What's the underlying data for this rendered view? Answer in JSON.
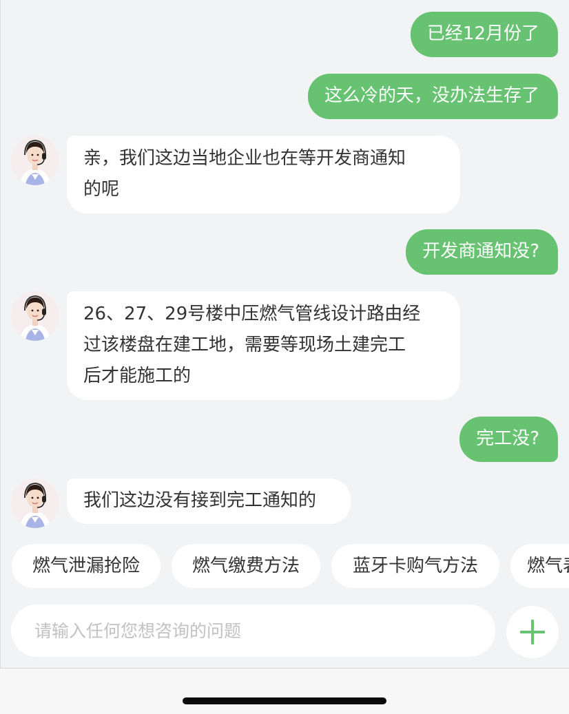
{
  "messages": [
    {
      "side": "out",
      "text": "已经12月份了"
    },
    {
      "side": "out",
      "text": "这么冷的天，没办法生存了"
    },
    {
      "side": "in",
      "lines": [
        "亲，我们这边当地企业也在等开发商通知",
        "的呢"
      ]
    },
    {
      "side": "out",
      "text": "开发商通知没?"
    },
    {
      "side": "in",
      "lines": [
        "26、27、29号楼中压燃气管线设计路由经",
        "过该楼盘在建工地，需要等现场土建完工",
        "后才能施工的"
      ]
    },
    {
      "side": "out",
      "text": "完工没?"
    },
    {
      "side": "in",
      "lines": [
        "我们这边没有接到完工通知的"
      ]
    }
  ],
  "quick_replies": [
    "燃气泄漏抢险",
    "燃气缴费方法",
    "蓝牙卡购气方法",
    "燃气表"
  ],
  "composer": {
    "placeholder": "请输入任何您想咨询的问题",
    "plus_icon": "plus-icon"
  },
  "colors": {
    "accent": "#67c272",
    "background": "#f2f3f5",
    "bubble_in": "#ffffff"
  }
}
